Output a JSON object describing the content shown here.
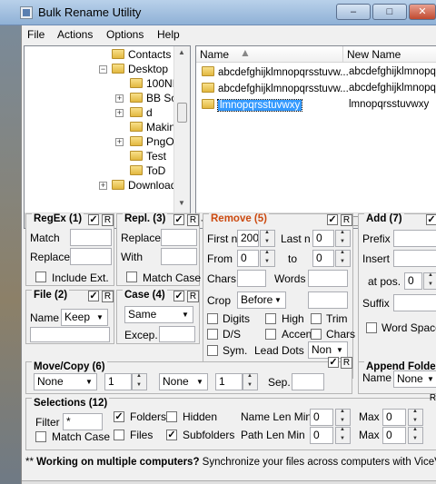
{
  "window": {
    "title": "Bulk Rename Utility"
  },
  "menu": [
    "File",
    "Actions",
    "Options",
    "Help"
  ],
  "tree": {
    "items": [
      "Contacts",
      "Desktop",
      "100ND",
      "BB So",
      "d",
      "Makin",
      "PngOp",
      "Test",
      "ToD",
      "Download"
    ]
  },
  "filelist": {
    "headers": {
      "name": "Name",
      "new_name": "New Name"
    },
    "rows": [
      {
        "name": "abcdefghijklmnopqrsstuvw...",
        "new_name": "abcdefghijklmnopq"
      },
      {
        "name": "abcdefghijklmnopqrsstuvw...",
        "new_name": "abcdefghijklmnopq"
      },
      {
        "name": "lmnopqrsstuvwxy",
        "new_name": "lmnopqrsstuvwxy"
      }
    ]
  },
  "regex": {
    "title": "RegEx (1)",
    "match_label": "Match",
    "replace_label": "Replace",
    "include_ext_label": "Include Ext.",
    "r": "R"
  },
  "repl": {
    "title": "Repl. (3)",
    "replace_label": "Replace",
    "with_label": "With",
    "match_case_label": "Match Case",
    "r": "R"
  },
  "remove": {
    "title": "Remove (5)",
    "first_n_label": "First n",
    "first_n_value": "200",
    "last_n_label": "Last n",
    "last_n_value": "0",
    "from_label": "From",
    "from_value": "0",
    "to_label": "to",
    "to_value": "0",
    "chars_label": "Chars",
    "words_label": "Words",
    "crop_label": "Crop",
    "crop_value": "Before",
    "digits_label": "Digits",
    "high_label": "High",
    "trim_label": "Trim",
    "ds_label": "D/S",
    "accents_label": "Accents",
    "chars2_label": "Chars",
    "sym_label": "Sym.",
    "lead_dots_label": "Lead Dots",
    "lead_dots_value": "Non",
    "r": "R"
  },
  "add": {
    "title": "Add (7)",
    "prefix_label": "Prefix",
    "insert_label": "Insert",
    "at_pos_label": "at pos.",
    "at_pos_value": "0",
    "suffix_label": "Suffix",
    "word_space_label": "Word Space"
  },
  "file": {
    "title": "File (2)",
    "name_label": "Name",
    "name_value": "Keep",
    "r": "R"
  },
  "case": {
    "title": "Case (4)",
    "case_value": "Same",
    "excep_label": "Excep.",
    "r": "R"
  },
  "movecopy": {
    "title": "Move/Copy (6)",
    "mode1": "None",
    "count1": "1",
    "mode2": "None",
    "count2": "1",
    "sep_label": "Sep.",
    "r": "R"
  },
  "append": {
    "title": "Append Folde",
    "name_label": "Name",
    "name_value": "None"
  },
  "selections": {
    "title": "Selections (12)",
    "filter_label": "Filter",
    "filter_value": "*",
    "folders_label": "Folders",
    "hidden_label": "Hidden",
    "match_case_label": "Match Case",
    "files_label": "Files",
    "subfolders_label": "Subfolders",
    "name_len_min_label": "Name Len Min",
    "name_len_min_value": "0",
    "path_len_min_label": "Path Len Min",
    "path_len_min_value": "0",
    "max_label": "Max",
    "max1_value": "0",
    "max2_value": "0",
    "r": "R"
  },
  "promo": {
    "bold": "Working on multiple computers?",
    "rest": " Synchronize your files across computers with ViceVer"
  }
}
